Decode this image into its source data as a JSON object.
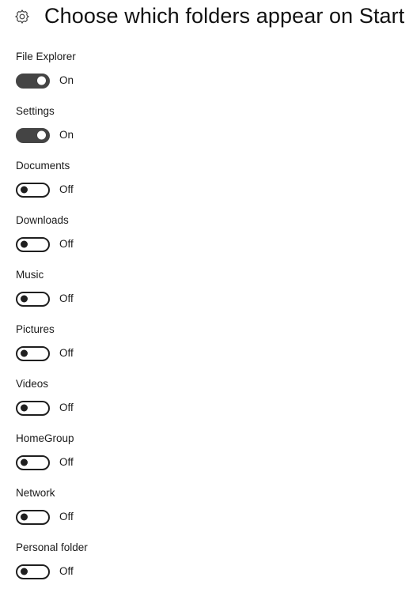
{
  "header": {
    "icon": "gear-icon",
    "title": "Choose which folders appear on Start"
  },
  "state_labels": {
    "on": "On",
    "off": "Off"
  },
  "settings": [
    {
      "label": "File Explorer",
      "state": "On",
      "on": true
    },
    {
      "label": "Settings",
      "state": "On",
      "on": true
    },
    {
      "label": "Documents",
      "state": "Off",
      "on": false
    },
    {
      "label": "Downloads",
      "state": "Off",
      "on": false
    },
    {
      "label": "Music",
      "state": "Off",
      "on": false
    },
    {
      "label": "Pictures",
      "state": "Off",
      "on": false
    },
    {
      "label": "Videos",
      "state": "Off",
      "on": false
    },
    {
      "label": "HomeGroup",
      "state": "Off",
      "on": false
    },
    {
      "label": "Network",
      "state": "Off",
      "on": false
    },
    {
      "label": "Personal folder",
      "state": "Off",
      "on": false
    }
  ],
  "colors": {
    "background": "#ffffff",
    "text": "#1a1a1a",
    "toggle_on_fill": "#444444",
    "toggle_off_border": "#1f1f1f",
    "knob_on": "#ffffff",
    "knob_off": "#1f1f1f"
  }
}
